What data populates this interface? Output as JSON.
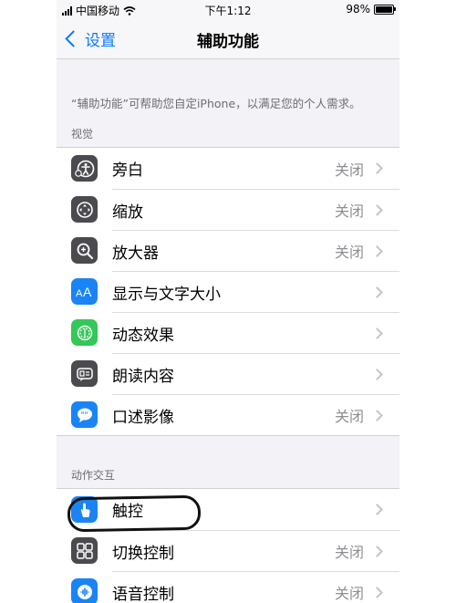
{
  "status_bar": {
    "carrier": "中国移动",
    "time": "下午1:12",
    "battery": "98%",
    "battery_level": 0.98
  },
  "nav": {
    "back_label": "设置",
    "title": "辅助功能"
  },
  "description": "“辅助功能”可帮助您自定iPhone，以满足您的个人需求。",
  "sections": [
    {
      "header": "视觉",
      "items": [
        {
          "label": "旁白",
          "value": "关闭",
          "icon": "voiceover-icon"
        },
        {
          "label": "缩放",
          "value": "关闭",
          "icon": "zoom-icon"
        },
        {
          "label": "放大器",
          "value": "关闭",
          "icon": "magnifier-icon"
        },
        {
          "label": "显示与文字大小",
          "value": "",
          "icon": "text-size-icon"
        },
        {
          "label": "动态效果",
          "value": "",
          "icon": "motion-icon"
        },
        {
          "label": "朗读内容",
          "value": "",
          "icon": "spoken-content-icon"
        },
        {
          "label": "口述影像",
          "value": "关闭",
          "icon": "audio-descriptions-icon"
        }
      ]
    },
    {
      "header": "动作交互",
      "items": [
        {
          "label": "触控",
          "value": "",
          "icon": "touch-icon"
        },
        {
          "label": "切换控制",
          "value": "关闭",
          "icon": "switch-control-icon"
        },
        {
          "label": "语音控制",
          "value": "关闭",
          "icon": "voice-control-icon"
        }
      ]
    }
  ]
}
